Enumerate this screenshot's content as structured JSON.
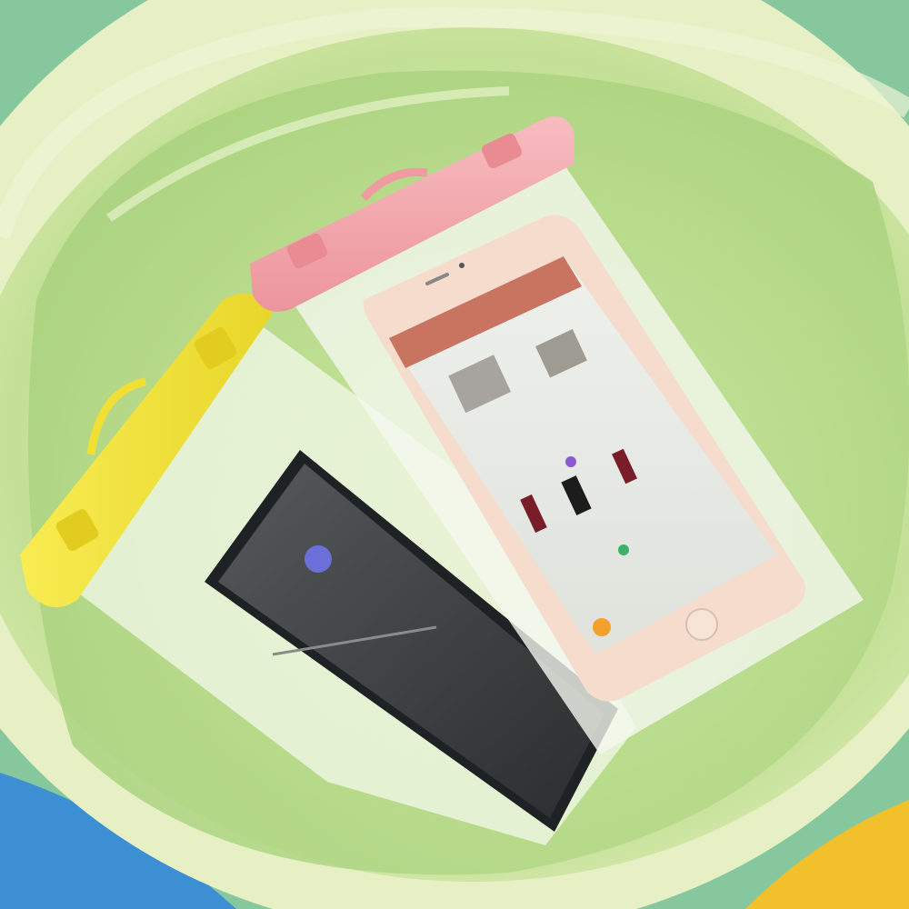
{
  "scene": {
    "colors": {
      "basin_rim": "#d9eab2",
      "basin_inner": "#c6e39a",
      "water": "#b7dc8a",
      "pink_clip": "#f2a5ab",
      "yellow_clip": "#f4e335",
      "phone_gold": "#f6d9c9",
      "phone_dark": "#2e3234",
      "pouch": "#f2f7ea",
      "accent_blue": "#2a8fd9",
      "accent_orange": "#f2a22c"
    },
    "objects": {
      "basin": "plastic-basin",
      "water": "water",
      "pouch_pink": "waterproof-pouch-pink-clip",
      "pouch_yellow": "waterproof-pouch-yellow-clip",
      "phone_gold": "smartphone-rose-gold",
      "phone_dark": "smartphone-dark"
    }
  }
}
